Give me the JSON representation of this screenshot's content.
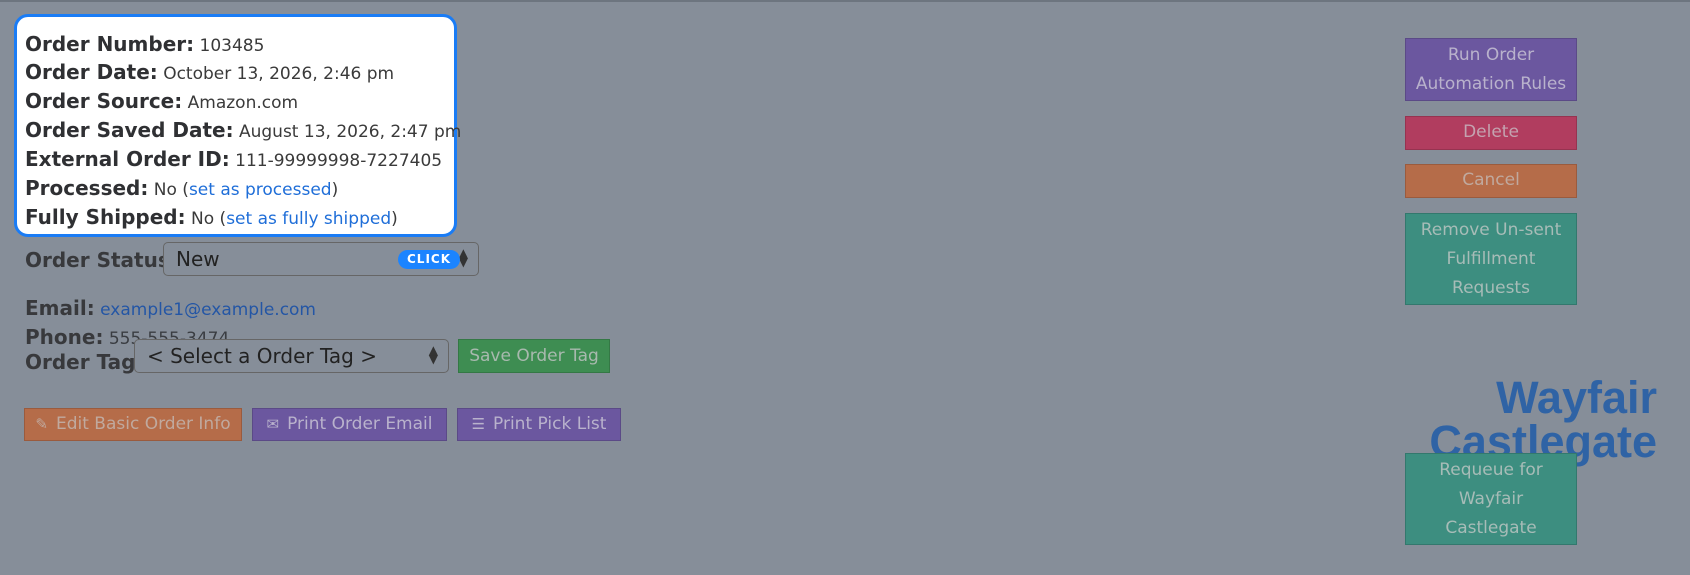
{
  "order": {
    "number_label": "Order Number:",
    "number": "103485",
    "date_label": "Order Date:",
    "date": "October 13, 2026, 2:46 pm",
    "source_label": "Order Source:",
    "source": "Amazon.com",
    "saved_label": "Order Saved Date:",
    "saved": "August 13, 2026, 2:47 pm",
    "external_label": "External Order ID:",
    "external": "111-99999998-7227405",
    "processed_label": "Processed:",
    "processed": "No (",
    "processed_link": "set as processed",
    "processed_close": ")",
    "shipped_label": "Fully Shipped:",
    "shipped": "No (",
    "shipped_link": "set as fully shipped",
    "shipped_close": ")"
  },
  "status": {
    "label": "Order Status:",
    "value": "New",
    "badge": "CLICK"
  },
  "contact": {
    "email_label": "Email:",
    "email": "example1@example.com",
    "phone_label": "Phone:",
    "phone": "555-555-3474"
  },
  "tag": {
    "label": "Order Tag:",
    "placeholder": "< Select a Order Tag >",
    "save": "Save Order Tag"
  },
  "actions": {
    "edit": "Edit Basic Order Info",
    "print_email": "Print Order Email",
    "pick_list": "Print Pick List"
  },
  "sidebar": {
    "run_rules_line1": "Run Order",
    "run_rules_line2": "Automation Rules",
    "delete": "Delete",
    "cancel": "Cancel",
    "remove_line1": "Remove Un-sent",
    "remove_line2": "Fulfillment",
    "remove_line3": "Requests",
    "brand_line1": "Wayfair",
    "brand_line2": "Castlegate",
    "requeue_line1": "Requeue for",
    "requeue_line2": "Wayfair",
    "requeue_line3": "Castlegate"
  },
  "colors": {
    "overlay": "#868e99",
    "highlight": "#1a7cf5",
    "link": "#1f6ed8",
    "green": "#3e8d52",
    "orange": "#b56c49",
    "purple": "#6b579f",
    "red": "#b13d5f",
    "teal": "#3d8e80",
    "brand": "#2f63a5"
  },
  "icons": {
    "edit": "pencil-icon",
    "email": "envelope-icon",
    "pick": "list-icon",
    "select": "chevron-updown-icon"
  }
}
